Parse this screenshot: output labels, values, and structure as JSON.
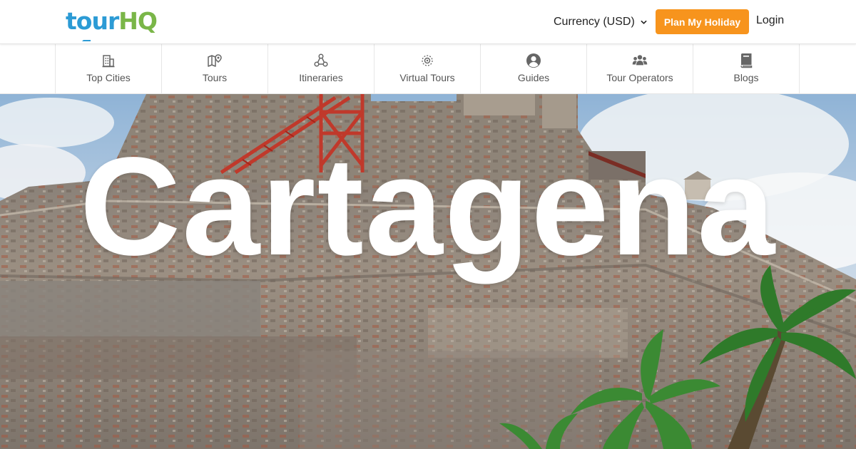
{
  "header": {
    "logo": {
      "part1": "t",
      "part2": "o",
      "part3": "ur",
      "part4": "HQ"
    },
    "currency_label": "Currency (USD)",
    "plan_button": "Plan My Holiday",
    "login_label": "Login"
  },
  "nav": {
    "items": [
      {
        "label": "Top Cities",
        "icon": "city-icon"
      },
      {
        "label": "Tours",
        "icon": "map-pin-icon"
      },
      {
        "label": "Itineraries",
        "icon": "itinerary-icon"
      },
      {
        "label": "Virtual Tours",
        "icon": "virtual-tour-icon"
      },
      {
        "label": "Guides",
        "icon": "user-circle-icon"
      },
      {
        "label": "Tour Operators",
        "icon": "users-icon"
      },
      {
        "label": "Blogs",
        "icon": "book-icon"
      }
    ]
  },
  "hero": {
    "title": "Cartagena",
    "image": "castle-fortress-photo"
  },
  "colors": {
    "brand_blue": "#2c9bd5",
    "brand_green": "#7ab648",
    "accent_orange": "#f7941d"
  }
}
